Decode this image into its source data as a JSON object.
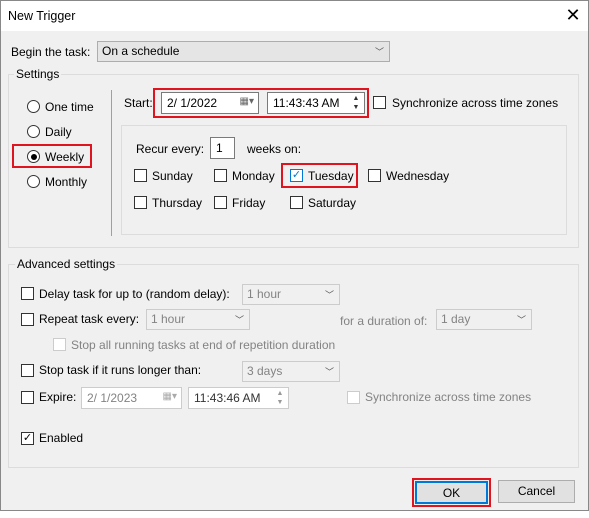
{
  "window": {
    "title": "New Trigger",
    "close": "✕"
  },
  "begin": {
    "label": "Begin the task:",
    "value": "On a schedule"
  },
  "settings": {
    "label": "Settings",
    "radios": [
      {
        "label": "One time",
        "checked": false
      },
      {
        "label": "Daily",
        "checked": false
      },
      {
        "label": "Weekly",
        "checked": true
      },
      {
        "label": "Monthly",
        "checked": false
      }
    ],
    "start_label": "Start:",
    "start_date": "2/  1/2022",
    "start_time": "11:43:43 AM",
    "sync_label": "Synchronize across time zones",
    "recur_label": "Recur every:",
    "recur_value": "1",
    "weeks_on": "weeks on:",
    "days": [
      {
        "label": "Sunday",
        "checked": false
      },
      {
        "label": "Monday",
        "checked": false
      },
      {
        "label": "Tuesday",
        "checked": true
      },
      {
        "label": "Wednesday",
        "checked": false
      },
      {
        "label": "Thursday",
        "checked": false
      },
      {
        "label": "Friday",
        "checked": false
      },
      {
        "label": "Saturday",
        "checked": false
      }
    ]
  },
  "advanced": {
    "label": "Advanced settings",
    "delay_label": "Delay task for up to (random delay):",
    "delay_value": "1 hour",
    "repeat_label": "Repeat task every:",
    "repeat_value": "1 hour",
    "duration_label": "for a duration of:",
    "duration_value": "1 day",
    "stop_all_label": "Stop all running tasks at end of repetition duration",
    "stop_label": "Stop task if it runs longer than:",
    "stop_value": "3 days",
    "expire_label": "Expire:",
    "expire_date": "2/  1/2023",
    "expire_time": "11:43:46 AM",
    "expire_sync_label": "Synchronize across time zones",
    "enabled_label": "Enabled",
    "enabled": true
  },
  "buttons": {
    "ok": "OK",
    "cancel": "Cancel"
  },
  "colors": {
    "highlight": "#e0141e",
    "focus": "#0078d7"
  }
}
